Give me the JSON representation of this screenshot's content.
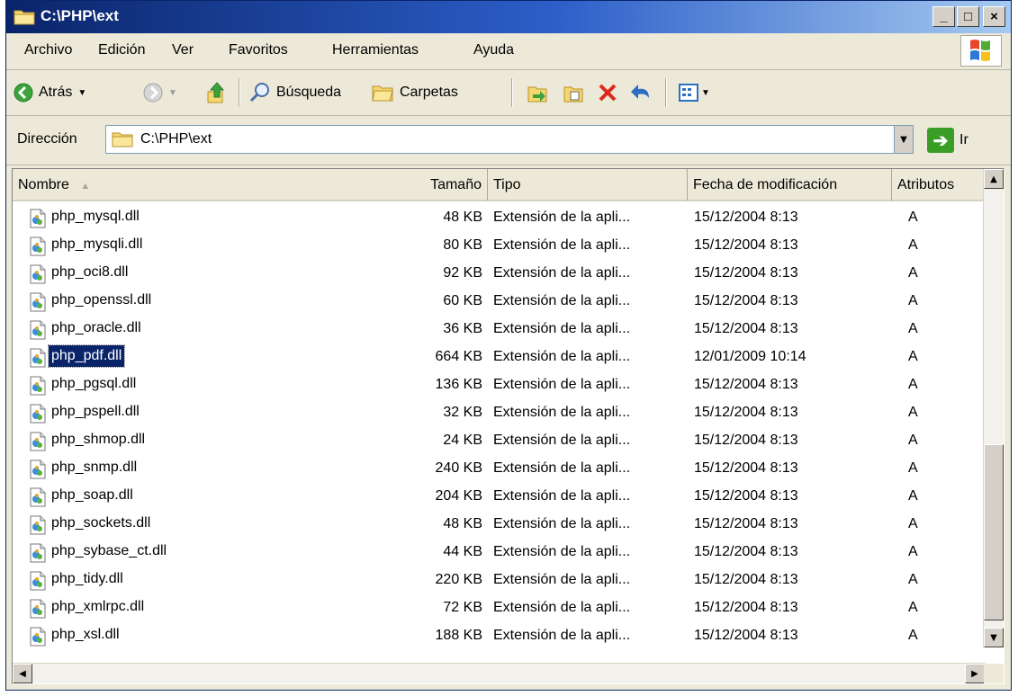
{
  "window": {
    "title": "C:\\PHP\\ext",
    "minimize": "_",
    "maximize": "□",
    "close": "×"
  },
  "menu": {
    "items": [
      "Archivo",
      "Edición",
      "Ver",
      "Favoritos",
      "Herramientas",
      "Ayuda"
    ]
  },
  "toolbar": {
    "back": "Atrás",
    "search": "Búsqueda",
    "folders": "Carpetas"
  },
  "address": {
    "label": "Dirección",
    "value": "C:\\PHP\\ext",
    "go": "Ir"
  },
  "list": {
    "columns": [
      "Nombre",
      "Tamaño",
      "Tipo",
      "Fecha de modificación",
      "Atributos"
    ],
    "rows": [
      {
        "name": "php_mysql.dll",
        "size": "48 KB",
        "type": "Extensión de la apli...",
        "date": "15/12/2004 8:13",
        "attr": "A"
      },
      {
        "name": "php_mysqli.dll",
        "size": "80 KB",
        "type": "Extensión de la apli...",
        "date": "15/12/2004 8:13",
        "attr": "A"
      },
      {
        "name": "php_oci8.dll",
        "size": "92 KB",
        "type": "Extensión de la apli...",
        "date": "15/12/2004 8:13",
        "attr": "A"
      },
      {
        "name": "php_openssl.dll",
        "size": "60 KB",
        "type": "Extensión de la apli...",
        "date": "15/12/2004 8:13",
        "attr": "A"
      },
      {
        "name": "php_oracle.dll",
        "size": "36 KB",
        "type": "Extensión de la apli...",
        "date": "15/12/2004 8:13",
        "attr": "A"
      },
      {
        "name": "php_pdf.dll",
        "size": "664 KB",
        "type": "Extensión de la apli...",
        "date": "12/01/2009 10:14",
        "attr": "A",
        "selected": true
      },
      {
        "name": "php_pgsql.dll",
        "size": "136 KB",
        "type": "Extensión de la apli...",
        "date": "15/12/2004 8:13",
        "attr": "A"
      },
      {
        "name": "php_pspell.dll",
        "size": "32 KB",
        "type": "Extensión de la apli...",
        "date": "15/12/2004 8:13",
        "attr": "A"
      },
      {
        "name": "php_shmop.dll",
        "size": "24 KB",
        "type": "Extensión de la apli...",
        "date": "15/12/2004 8:13",
        "attr": "A"
      },
      {
        "name": "php_snmp.dll",
        "size": "240 KB",
        "type": "Extensión de la apli...",
        "date": "15/12/2004 8:13",
        "attr": "A"
      },
      {
        "name": "php_soap.dll",
        "size": "204 KB",
        "type": "Extensión de la apli...",
        "date": "15/12/2004 8:13",
        "attr": "A"
      },
      {
        "name": "php_sockets.dll",
        "size": "48 KB",
        "type": "Extensión de la apli...",
        "date": "15/12/2004 8:13",
        "attr": "A"
      },
      {
        "name": "php_sybase_ct.dll",
        "size": "44 KB",
        "type": "Extensión de la apli...",
        "date": "15/12/2004 8:13",
        "attr": "A"
      },
      {
        "name": "php_tidy.dll",
        "size": "220 KB",
        "type": "Extensión de la apli...",
        "date": "15/12/2004 8:13",
        "attr": "A"
      },
      {
        "name": "php_xmlrpc.dll",
        "size": "72 KB",
        "type": "Extensión de la apli...",
        "date": "15/12/2004 8:13",
        "attr": "A"
      },
      {
        "name": "php_xsl.dll",
        "size": "188 KB",
        "type": "Extensión de la apli...",
        "date": "15/12/2004 8:13",
        "attr": "A"
      }
    ]
  },
  "colors": {
    "selection": "#0A246A",
    "titlebar": "#0A246A",
    "face": "#ECE9D8"
  }
}
